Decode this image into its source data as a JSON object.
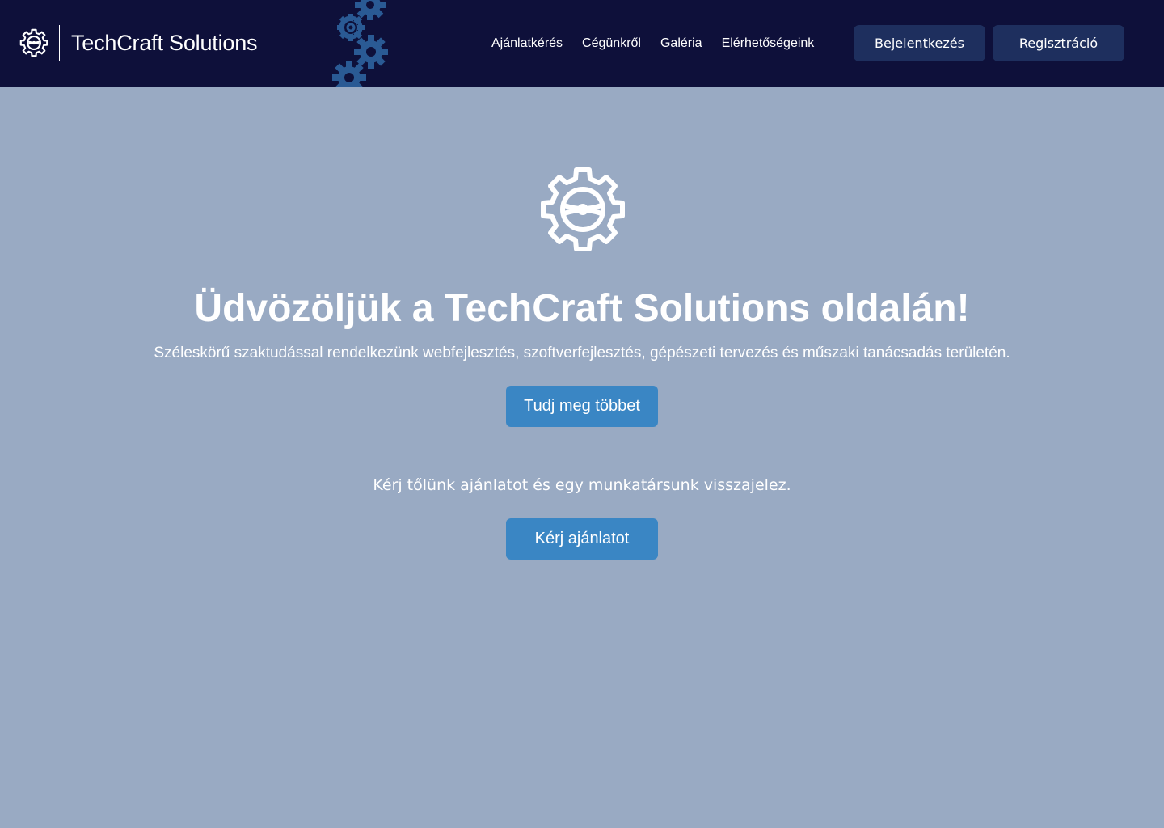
{
  "header": {
    "brand_name": "TechCraft Solutions",
    "nav": [
      {
        "label": "Ajánlatkérés"
      },
      {
        "label": "Cégünkről"
      },
      {
        "label": "Galéria"
      },
      {
        "label": "Elérhetőségeink"
      }
    ],
    "login_label": "Bejelentkezés",
    "register_label": "Regisztráció"
  },
  "hero": {
    "icon": "gear-wheel-icon",
    "title": "Üdvözöljük a TechCraft Solutions oldalán!",
    "subtitle": "Széleskörű szaktudással rendelkezünk webfejlesztés, szoftverfejlesztés, gépészeti tervezés és műszaki tanácsadás területén.",
    "more_button": "Tudj meg többet",
    "offer_text": "Kérj tőlünk ajánlatot és egy munkatársunk visszajelez.",
    "quote_button": "Kérj ajánlatot"
  },
  "colors": {
    "header_bg": "#0e103a",
    "page_bg": "#99aac3",
    "header_button_bg": "#1e2f5e",
    "accent": "#3a86c4",
    "decor_gear": "#2a5a94"
  }
}
